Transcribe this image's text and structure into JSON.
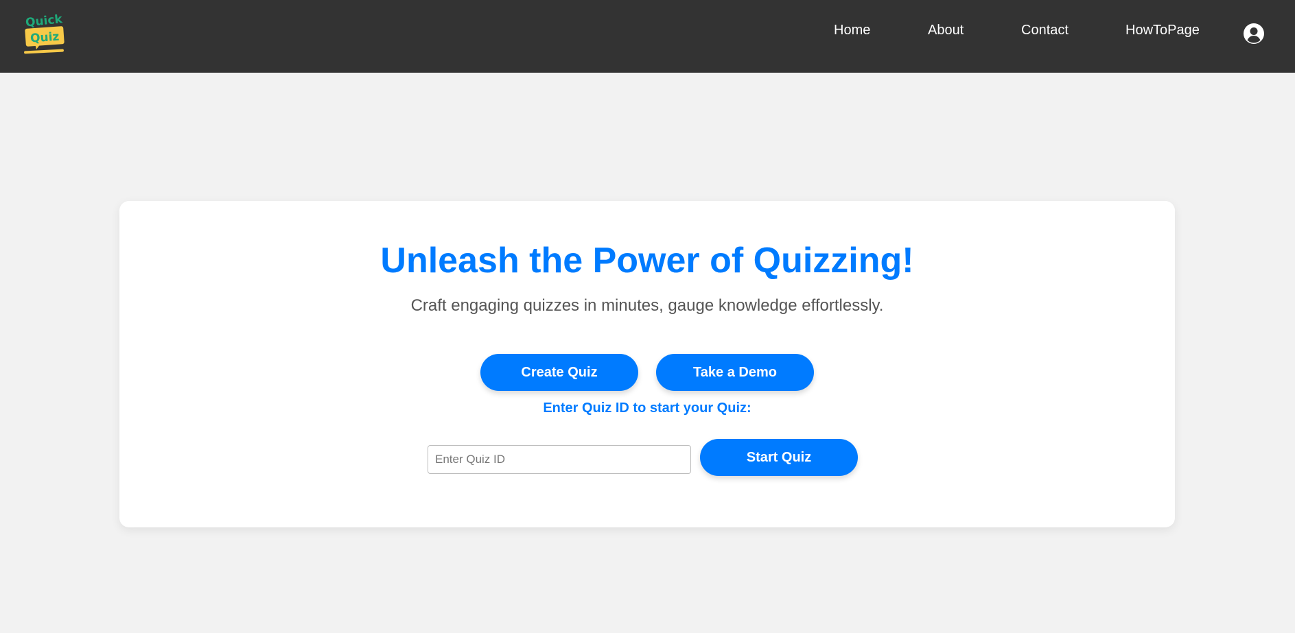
{
  "app": {
    "logo_alt": "Quick Quiz logo",
    "logo_text_line1": "Quick",
    "logo_text_line2": "Quiz"
  },
  "nav": {
    "items": [
      {
        "label": "Home"
      },
      {
        "label": "About"
      },
      {
        "label": "Contact"
      },
      {
        "label": "HowToPage"
      }
    ],
    "profile_icon": "user-circle-icon"
  },
  "hero": {
    "title": "Unleash the Power of Quizzing!",
    "subtitle": "Craft engaging quizzes in minutes, gauge knowledge effortlessly.",
    "create_label": "Create Quiz",
    "demo_label": "Take a Demo",
    "quiz_id_prompt": "Enter Quiz ID to start your Quiz:",
    "quiz_id_placeholder": "Enter Quiz ID",
    "quiz_id_value": "",
    "start_label": "Start Quiz"
  },
  "colors": {
    "navbar": "#333333",
    "accent": "#007bff",
    "background": "#f2f2f2",
    "logo_green": "#1fa97a",
    "logo_yellow": "#f7c948"
  }
}
